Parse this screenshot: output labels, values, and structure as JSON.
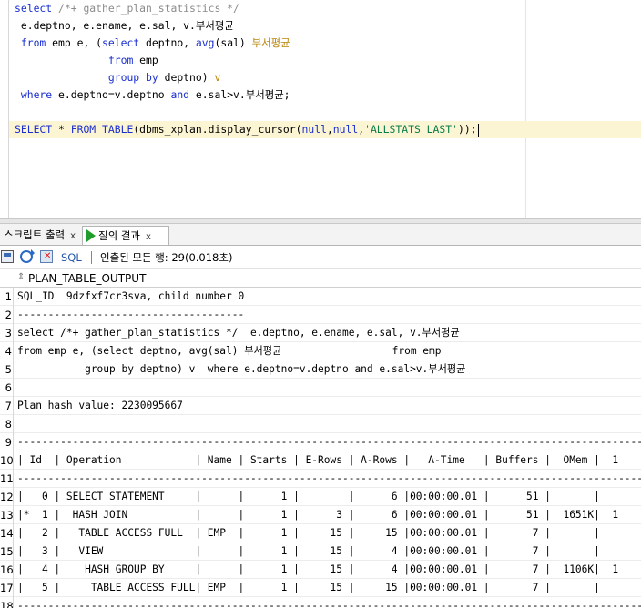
{
  "editor": {
    "lines": [
      [
        {
          "t": "select",
          "c": "kw"
        },
        {
          "t": " "
        },
        {
          "t": "/*+ gather_plan_statistics */",
          "c": "cm"
        }
      ],
      [
        {
          "t": " e.deptno, e.ename, e.sal, v.부서평균"
        }
      ],
      [
        {
          "t": " "
        },
        {
          "t": "from",
          "c": "kw"
        },
        {
          "t": " emp e, ("
        },
        {
          "t": "select",
          "c": "kw"
        },
        {
          "t": " deptno, "
        },
        {
          "t": "avg",
          "c": "kw"
        },
        {
          "t": "(sal) "
        },
        {
          "t": "부서평균",
          "c": "al"
        }
      ],
      [
        {
          "t": "               "
        },
        {
          "t": "from",
          "c": "kw"
        },
        {
          "t": " emp"
        }
      ],
      [
        {
          "t": "               "
        },
        {
          "t": "group by",
          "c": "kw"
        },
        {
          "t": " deptno) "
        },
        {
          "t": "v",
          "c": "al"
        }
      ],
      [
        {
          "t": " "
        },
        {
          "t": "where",
          "c": "kw"
        },
        {
          "t": " e.deptno=v.deptno "
        },
        {
          "t": "and",
          "c": "kw"
        },
        {
          "t": " e.sal>v.부서평균;"
        }
      ],
      [],
      [
        {
          "t": "SELECT",
          "c": "kw"
        },
        {
          "t": " * "
        },
        {
          "t": "FROM",
          "c": "kw"
        },
        {
          "t": " "
        },
        {
          "t": "TABLE",
          "c": "kw"
        },
        {
          "t": "(dbms_xplan.display_cursor("
        },
        {
          "t": "null",
          "c": "kw"
        },
        {
          "t": ","
        },
        {
          "t": "null",
          "c": "kw"
        },
        {
          "t": ","
        },
        {
          "t": "'ALLSTATS LAST'",
          "c": "st"
        },
        {
          "t": "));"
        }
      ]
    ],
    "current_line": 7
  },
  "tabs": [
    {
      "label": "스크립트 출력",
      "close": "x",
      "active": false,
      "icon": "none"
    },
    {
      "label": "질의 결과",
      "close": "x",
      "active": true,
      "icon": "play-icon"
    }
  ],
  "toolbar": {
    "sql_label": "SQL",
    "separator": "|",
    "status": "인출된 모든 행: 29(0.018초)",
    "icons": [
      "print-icon",
      "refresh-icon",
      "clear-icon"
    ]
  },
  "grid": {
    "column_header": "PLAN_TABLE_OUTPUT",
    "rows": [
      {
        "n": "1",
        "text": "SQL_ID  9dzfxf7cr3sva, child number 0"
      },
      {
        "n": "2",
        "text": "-------------------------------------"
      },
      {
        "n": "3",
        "text": "select /*+ gather_plan_statistics */  e.deptno, e.ename, e.sal, v.부서평균"
      },
      {
        "n": "4",
        "text": "from emp e, (select deptno, avg(sal) 부서평균                  from emp"
      },
      {
        "n": "5",
        "text": "           group by deptno) v  where e.deptno=v.deptno and e.sal>v.부서평균"
      },
      {
        "n": "6",
        "text": ""
      },
      {
        "n": "7",
        "text": "Plan hash value: 2230095667"
      },
      {
        "n": "8",
        "text": ""
      },
      {
        "n": "9",
        "text": "------------------------------------------------------------------------------------------------------------"
      },
      {
        "n": "10",
        "text": "| Id  | Operation            | Name | Starts | E-Rows | A-Rows |   A-Time   | Buffers |  OMem |  1"
      },
      {
        "n": "11",
        "text": "------------------------------------------------------------------------------------------------------------"
      },
      {
        "n": "12",
        "text": "|   0 | SELECT STATEMENT     |      |      1 |        |      6 |00:00:00.01 |      51 |       |"
      },
      {
        "n": "13",
        "text": "|*  1 |  HASH JOIN           |      |      1 |      3 |      6 |00:00:00.01 |      51 |  1651K|  1"
      },
      {
        "n": "14",
        "text": "|   2 |   TABLE ACCESS FULL  | EMP  |      1 |     15 |     15 |00:00:00.01 |       7 |       |"
      },
      {
        "n": "15",
        "text": "|   3 |   VIEW               |      |      1 |     15 |      4 |00:00:00.01 |       7 |       |"
      },
      {
        "n": "16",
        "text": "|   4 |    HASH GROUP BY     |      |      1 |     15 |      4 |00:00:00.01 |       7 |  1106K|  1"
      },
      {
        "n": "17",
        "text": "|   5 |     TABLE ACCESS FULL| EMP  |      1 |     15 |     15 |00:00:00.01 |       7 |       |"
      },
      {
        "n": "18",
        "text": "------------------------------------------------------------------------------------------------------------"
      }
    ]
  }
}
